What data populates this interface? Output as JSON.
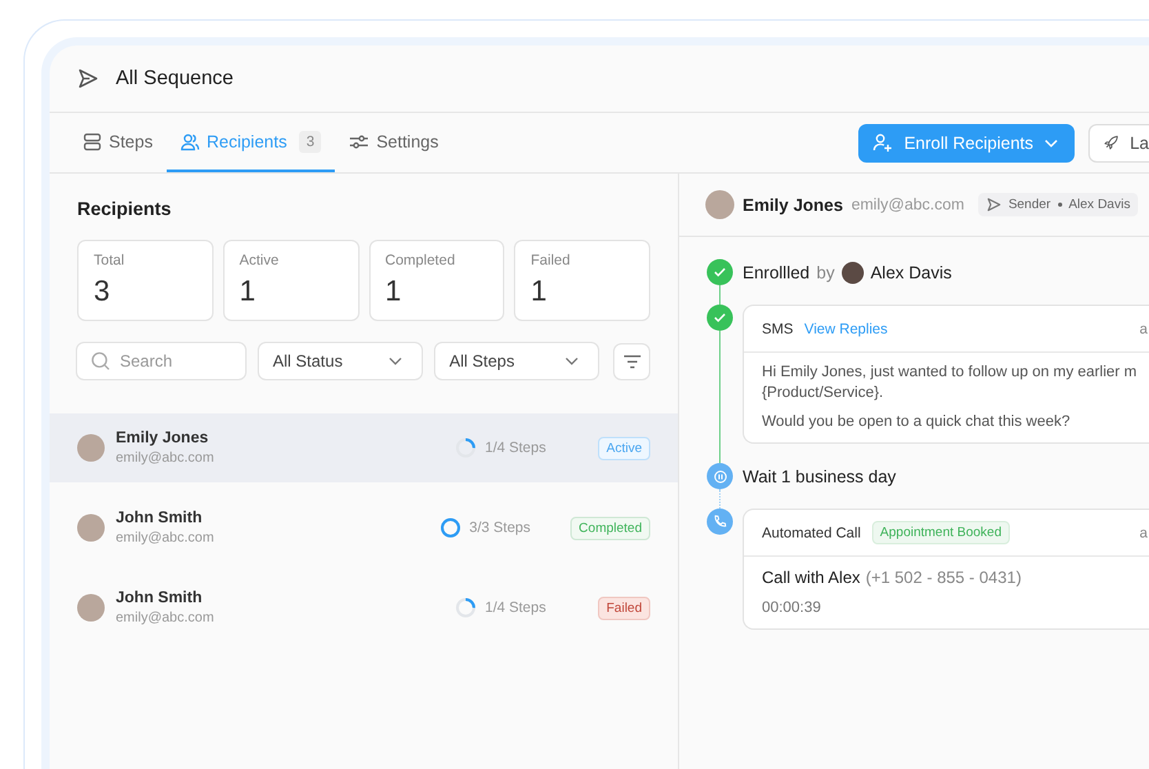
{
  "header": {
    "title": "All Sequence"
  },
  "tabs": [
    {
      "label": "Steps",
      "selected": false
    },
    {
      "label": "Recipients",
      "count": "3",
      "selected": true
    },
    {
      "label": "Settings",
      "selected": false
    }
  ],
  "actions": [
    {
      "kind": "primary",
      "label": "Enroll Recipients"
    },
    {
      "kind": "secondary",
      "label": "La"
    }
  ],
  "recipients": {
    "title": "Recipients",
    "stats": [
      {
        "label": "Total",
        "value": "3"
      },
      {
        "label": "Active",
        "value": "1"
      },
      {
        "label": "Completed",
        "value": "1"
      },
      {
        "label": "Failed",
        "value": "1"
      }
    ],
    "search": {
      "placeholder": "Search"
    },
    "filters": [
      "All Status",
      "All Steps"
    ],
    "rows": [
      {
        "name": "Emily Jones",
        "email": "emily@abc.com",
        "level": 0.25,
        "steps": "1/4 Steps",
        "status": "Active",
        "kind": "active",
        "selected": true
      },
      {
        "name": "John Smith",
        "email": "emily@abc.com",
        "level": 1,
        "steps": "3/3 Steps",
        "status": "Completed",
        "kind": "completed",
        "selected": false
      },
      {
        "name": "John Smith",
        "email": "emily@abc.com",
        "level": 0.25,
        "steps": "1/4 Steps",
        "status": "Failed",
        "kind": "failed",
        "selected": false
      }
    ]
  },
  "detail": {
    "name": "Emily Jones",
    "email": "emily@abc.com",
    "sender_label": "Sender",
    "sender": "Alex Davis",
    "steps": [
      {
        "kind": "enrolled",
        "completed": true,
        "title": "Enrollled",
        "by": "by",
        "person": "Alex Davis"
      },
      {
        "kind": "sms",
        "completed": true,
        "title": "SMS",
        "link": "View Replies",
        "corner": "a",
        "lines": [
          "Hi Emily Jones, just wanted to follow up on my earlier m",
          "{Product/Service}."
        ],
        "question": "Would you be open to a quick chat this week?"
      },
      {
        "kind": "wait",
        "completed": false,
        "title": "Wait 1 business day"
      },
      {
        "kind": "call",
        "completed": false,
        "title": "Automated Call",
        "tag": "Appointment Booked",
        "corner": "a",
        "call_title": "Call with Alex",
        "phone": "(+1 502 - 855 - 0431)",
        "duration": "00:00:39"
      }
    ]
  }
}
